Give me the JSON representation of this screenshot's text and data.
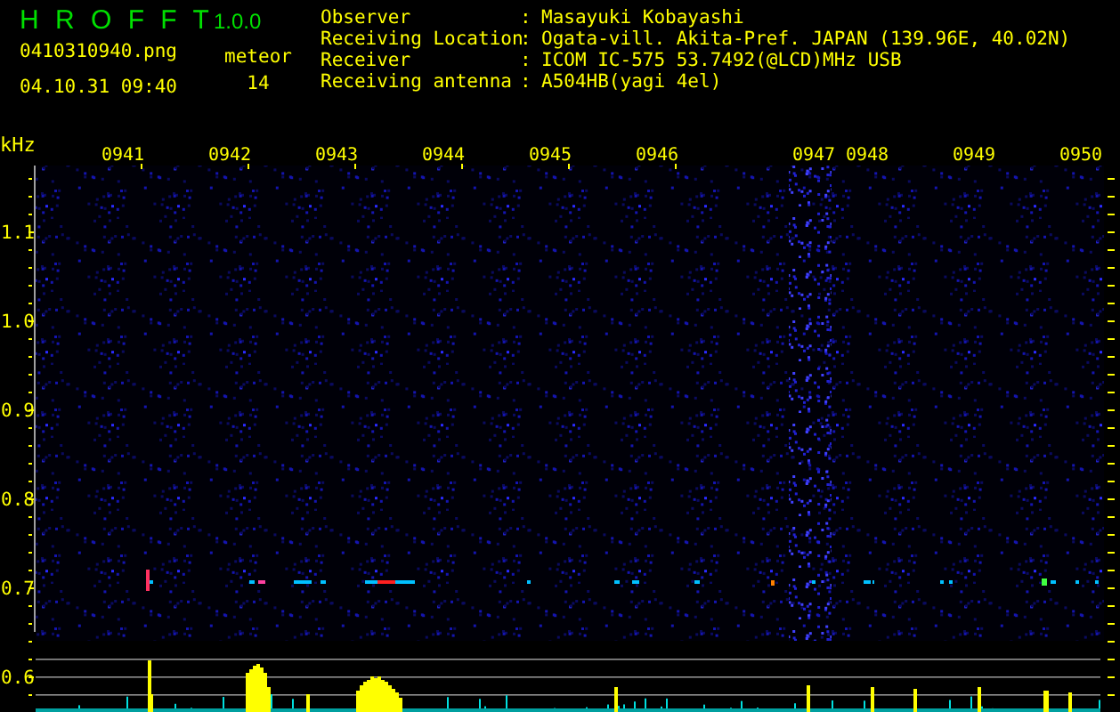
{
  "app": {
    "title": "H R O F F T",
    "version": "1.0.0"
  },
  "file": {
    "name": "0410310940.png",
    "datetime": "04.10.31 09:40"
  },
  "meteor": {
    "label": "meteor",
    "count": "14"
  },
  "info": [
    {
      "label": "Observer",
      "separator": ":",
      "value": "Masayuki Kobayashi"
    },
    {
      "label": "Receiving Location",
      "separator": ":",
      "value": "Ogata-vill. Akita-Pref. JAPAN (139.96E, 40.02N)"
    },
    {
      "label": "Receiver",
      "separator": ":",
      "value": "ICOM IC-575 53.7492(@LCD)MHz USB"
    },
    {
      "label": "Receiving antenna",
      "separator": ":",
      "value": "A504HB(yagi 4el)"
    }
  ],
  "spectrogram": {
    "unit": "kHz",
    "frequency_labels": [
      "1.1",
      "1.0",
      "0.9",
      "0.8",
      "0.7",
      "0.6"
    ],
    "time_labels": [
      "0941",
      "0942",
      "0943",
      "0944",
      "0945",
      "0946",
      "0947",
      "0948",
      "0949",
      "0950"
    ]
  }
}
